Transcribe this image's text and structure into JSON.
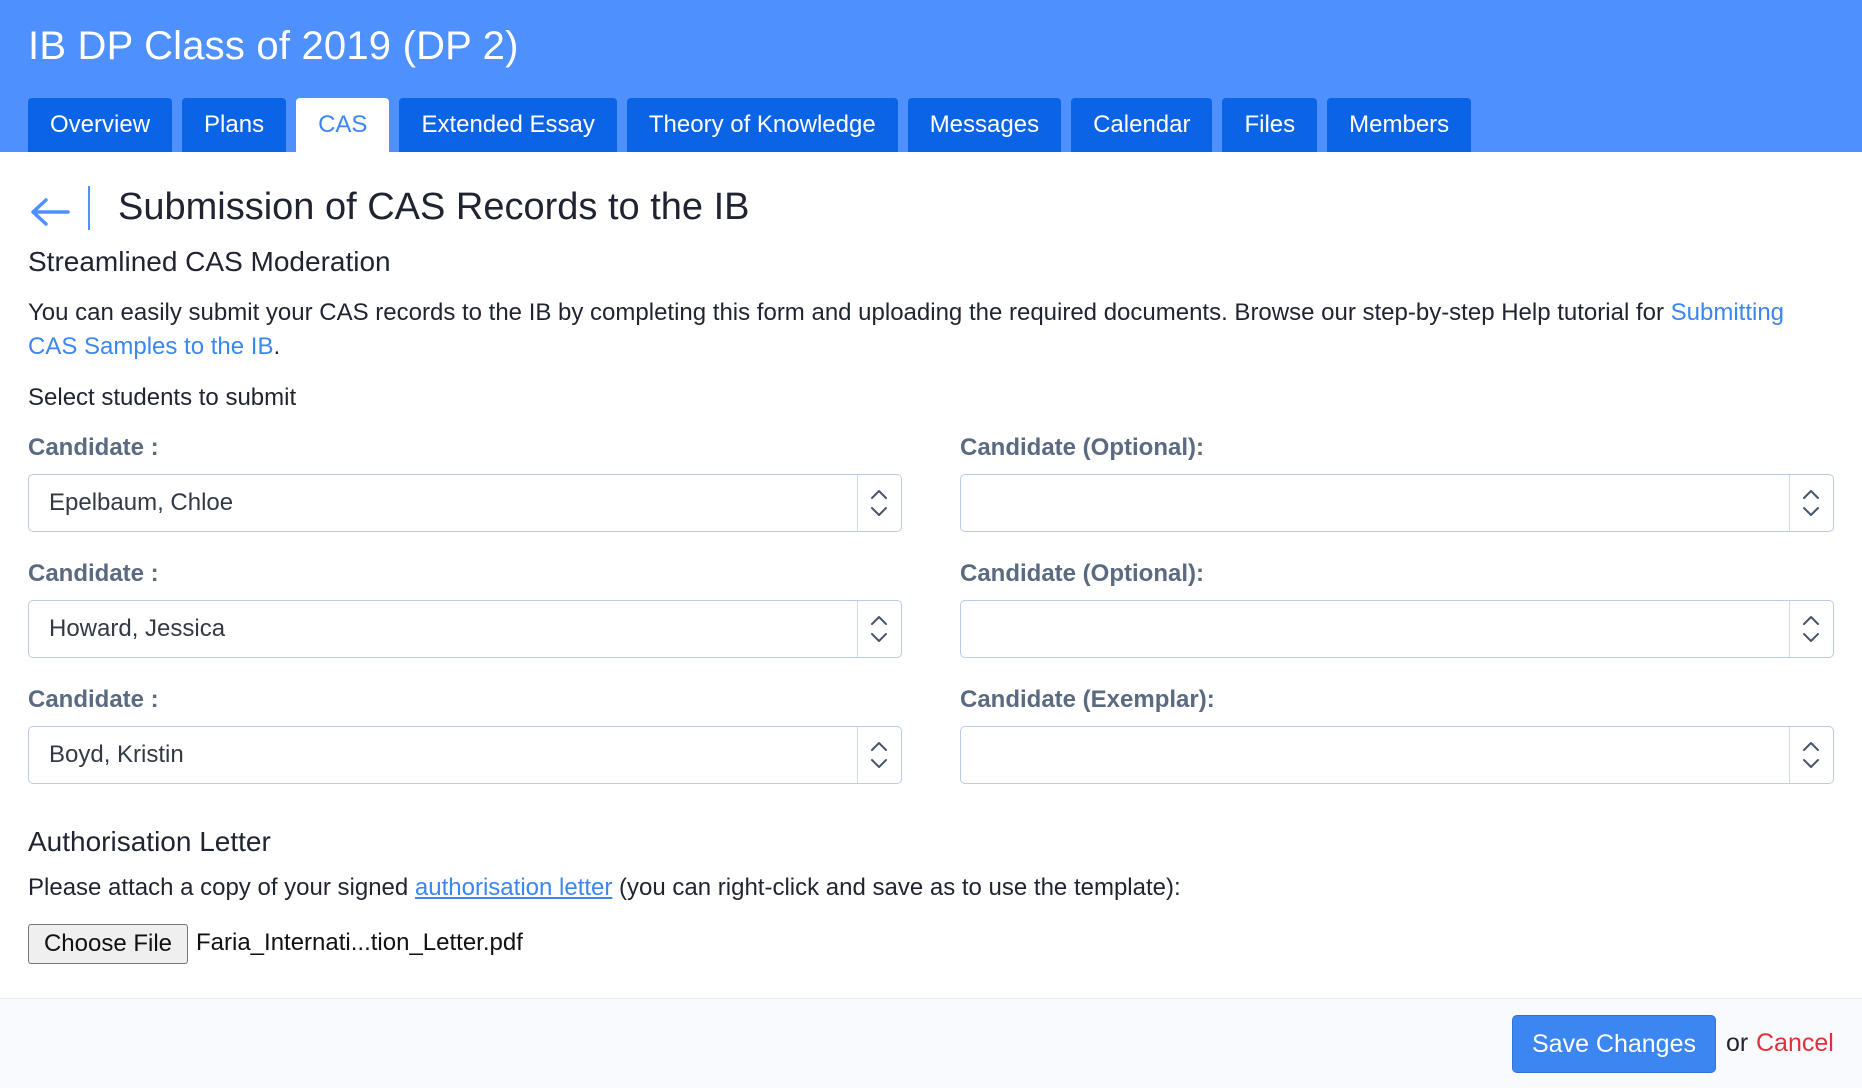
{
  "header": {
    "title": "IB DP Class of 2019 (DP 2)",
    "tabs": [
      {
        "label": "Overview",
        "active": false
      },
      {
        "label": "Plans",
        "active": false
      },
      {
        "label": "CAS",
        "active": true
      },
      {
        "label": "Extended Essay",
        "active": false
      },
      {
        "label": "Theory of Knowledge",
        "active": false
      },
      {
        "label": "Messages",
        "active": false
      },
      {
        "label": "Calendar",
        "active": false
      },
      {
        "label": "Files",
        "active": false
      },
      {
        "label": "Members",
        "active": false
      }
    ]
  },
  "page": {
    "back_icon": "arrow-left-icon",
    "title": "Submission of CAS Records to the IB",
    "subtitle": "Streamlined CAS Moderation",
    "description": "You can easily submit your CAS records to the IB by completing this form and uploading the required documents. Browse our step-by-step Help tutorial for",
    "description_link": "Submitting CAS Samples to the IB",
    "description_end": ".",
    "select_prompt": "Select students to submit"
  },
  "candidates": {
    "left": [
      {
        "label": "Candidate :",
        "value": "Epelbaum, Chloe"
      },
      {
        "label": "Candidate :",
        "value": "Howard, Jessica"
      },
      {
        "label": "Candidate :",
        "value": "Boyd, Kristin"
      }
    ],
    "right": [
      {
        "label": "Candidate (Optional):",
        "value": ""
      },
      {
        "label": "Candidate (Optional):",
        "value": ""
      },
      {
        "label": "Candidate (Exemplar):",
        "value": ""
      }
    ]
  },
  "authorisation": {
    "heading": "Authorisation Letter",
    "text_before": "Please attach a copy of your signed",
    "link": "authorisation letter",
    "text_after": "(you can right-click and save as to use the template):",
    "choose_file_label": "Choose File",
    "file_name": "Faria_Internati...tion_Letter.pdf"
  },
  "footer": {
    "save_label": "Save Changes",
    "or_label": "or",
    "cancel_label": "Cancel"
  },
  "colors": {
    "header_bg": "#4d90fe",
    "tab_bg": "#0b63e5",
    "accent": "#3b86f0",
    "cancel": "#e0303a",
    "label": "#5a6a80"
  }
}
